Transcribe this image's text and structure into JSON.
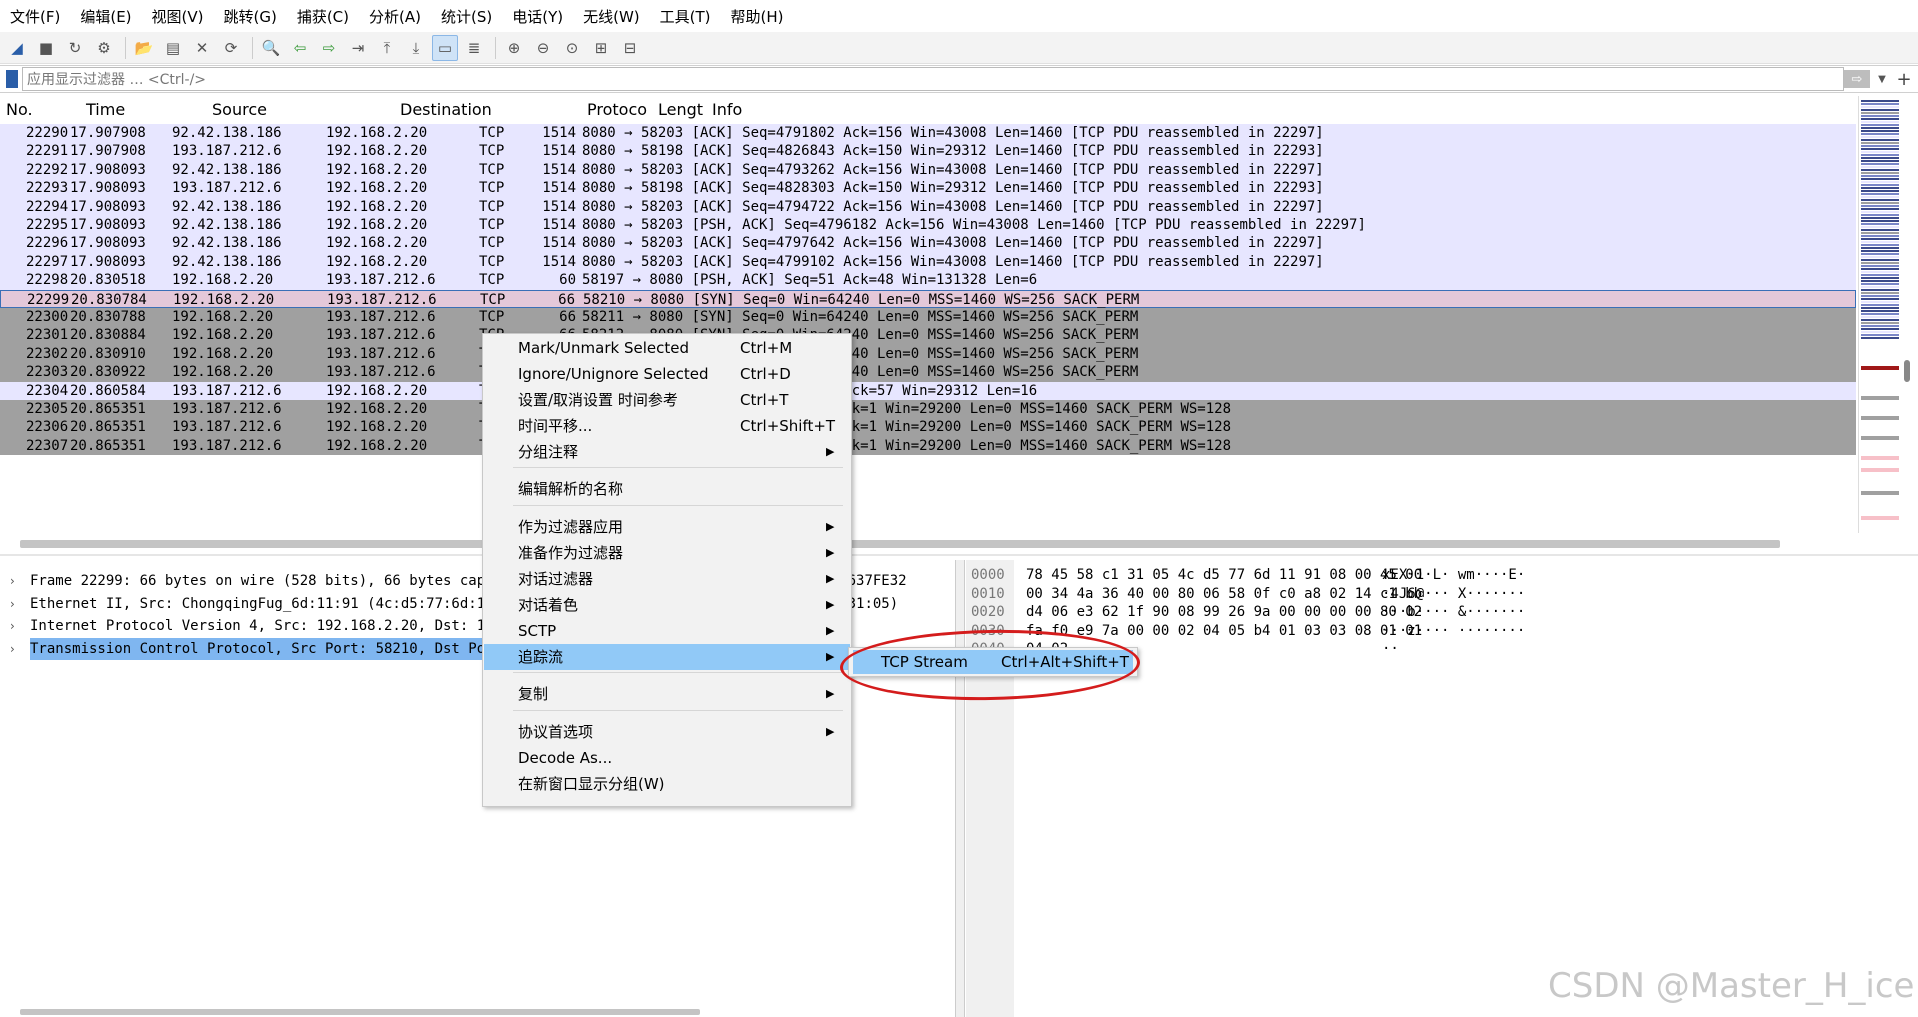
{
  "menubar": [
    "文件(F)",
    "编辑(E)",
    "视图(V)",
    "跳转(G)",
    "捕获(C)",
    "分析(A)",
    "统计(S)",
    "电话(Y)",
    "无线(W)",
    "工具(T)",
    "帮助(H)"
  ],
  "toolbar_icons": [
    "shark-fin-start-icon",
    "stop-icon",
    "restart-icon",
    "options-gear-icon",
    "open-folder-icon",
    "save-icon",
    "close-file-icon",
    "reload-icon",
    "find-icon",
    "back-arrow-icon",
    "forward-arrow-icon",
    "goto-packet-icon",
    "first-packet-icon",
    "last-packet-icon",
    "autoscroll-icon",
    "colorize-icon",
    "zoom-in-icon",
    "zoom-out-icon",
    "zoom-normal-icon",
    "resize-columns-icon",
    "layout-icon"
  ],
  "filter": {
    "placeholder": "应用显示过滤器 … <Ctrl-/>",
    "apply_glyph": "⇨",
    "add_glyph": "+"
  },
  "columns": {
    "no": "No.",
    "time": "Time",
    "source": "Source",
    "destination": "Destination",
    "protocol": "Protoco",
    "length": "Lengt",
    "info": "Info"
  },
  "packets": [
    {
      "no": "22290",
      "time": "17.907908",
      "src": "92.42.138.186",
      "dst": "192.168.2.20",
      "proto": "TCP",
      "len": "1514",
      "info": "8080 → 58203 [ACK] Seq=4791802 Ack=156 Win=43008 Len=1460 [TCP PDU reassembled in 22297]",
      "style": "tcp"
    },
    {
      "no": "22291",
      "time": "17.907908",
      "src": "193.187.212.6",
      "dst": "192.168.2.20",
      "proto": "TCP",
      "len": "1514",
      "info": "8080 → 58198 [ACK] Seq=4826843 Ack=150 Win=29312 Len=1460 [TCP PDU reassembled in 22293]",
      "style": "tcp"
    },
    {
      "no": "22292",
      "time": "17.908093",
      "src": "92.42.138.186",
      "dst": "192.168.2.20",
      "proto": "TCP",
      "len": "1514",
      "info": "8080 → 58203 [ACK] Seq=4793262 Ack=156 Win=43008 Len=1460 [TCP PDU reassembled in 22297]",
      "style": "tcp"
    },
    {
      "no": "22293",
      "time": "17.908093",
      "src": "193.187.212.6",
      "dst": "192.168.2.20",
      "proto": "TCP",
      "len": "1514",
      "info": "8080 → 58198 [ACK] Seq=4828303 Ack=150 Win=29312 Len=1460 [TCP PDU reassembled in 22293]",
      "style": "tcp"
    },
    {
      "no": "22294",
      "time": "17.908093",
      "src": "92.42.138.186",
      "dst": "192.168.2.20",
      "proto": "TCP",
      "len": "1514",
      "info": "8080 → 58203 [ACK] Seq=4794722 Ack=156 Win=43008 Len=1460 [TCP PDU reassembled in 22297]",
      "style": "tcp"
    },
    {
      "no": "22295",
      "time": "17.908093",
      "src": "92.42.138.186",
      "dst": "192.168.2.20",
      "proto": "TCP",
      "len": "1514",
      "info": "8080 → 58203 [PSH, ACK] Seq=4796182 Ack=156 Win=43008 Len=1460 [TCP PDU reassembled in 22297]",
      "style": "tcp"
    },
    {
      "no": "22296",
      "time": "17.908093",
      "src": "92.42.138.186",
      "dst": "192.168.2.20",
      "proto": "TCP",
      "len": "1514",
      "info": "8080 → 58203 [ACK] Seq=4797642 Ack=156 Win=43008 Len=1460 [TCP PDU reassembled in 22297]",
      "style": "tcp"
    },
    {
      "no": "22297",
      "time": "17.908093",
      "src": "92.42.138.186",
      "dst": "192.168.2.20",
      "proto": "TCP",
      "len": "1514",
      "info": "8080 → 58203 [ACK] Seq=4799102 Ack=156 Win=43008 Len=1460 [TCP PDU reassembled in 22297]",
      "style": "tcp"
    },
    {
      "no": "22298",
      "time": "20.830518",
      "src": "192.168.2.20",
      "dst": "193.187.212.6",
      "proto": "TCP",
      "len": "60",
      "info": "58197 → 8080 [PSH, ACK] Seq=51 Ack=48 Win=131328 Len=6",
      "style": "tcp"
    },
    {
      "no": "22299",
      "time": "20.830784",
      "src": "192.168.2.20",
      "dst": "193.187.212.6",
      "proto": "TCP",
      "len": "66",
      "info": "58210 → 8080 [SYN] Seq=0 Win=64240 Len=0 MSS=1460 WS=256 SACK_PERM",
      "style": "sel"
    },
    {
      "no": "22300",
      "time": "20.830788",
      "src": "192.168.2.20",
      "dst": "193.187.212.6",
      "proto": "TCP",
      "len": "66",
      "info": "58211 → 8080 [SYN] Seq=0 Win=64240 Len=0 MSS=1460 WS=256 SACK_PERM",
      "style": "gray"
    },
    {
      "no": "22301",
      "time": "20.830884",
      "src": "192.168.2.20",
      "dst": "193.187.212.6",
      "proto": "TCP",
      "len": "66",
      "info": "58212 → 8080 [SYN] Seq=0 Win=64240 Len=0 MSS=1460 WS=256 SACK_PERM",
      "style": "gray"
    },
    {
      "no": "22302",
      "time": "20.830910",
      "src": "192.168.2.20",
      "dst": "193.187.212.6",
      "proto": "TCP",
      "len": "66",
      "info": "58213 → 8080 [SYN] Seq=0 Win=64240 Len=0 MSS=1460 WS=256 SACK_PERM",
      "style": "gray"
    },
    {
      "no": "22303",
      "time": "20.830922",
      "src": "192.168.2.20",
      "dst": "193.187.212.6",
      "proto": "TCP",
      "len": "66",
      "info": "58214 → 8080 [SYN] Seq=0 Win=64240 Len=0 MSS=1460 WS=256 SACK_PERM",
      "style": "gray"
    },
    {
      "no": "22304",
      "time": "20.860584",
      "src": "193.187.212.6",
      "dst": "192.168.2.20",
      "proto": "TCP",
      "len": "54",
      "info": "8080 → 58197 [PSH, ACK] Seq=48 Ack=57 Win=29312 Len=16",
      "style": "tcp"
    },
    {
      "no": "22305",
      "time": "20.865351",
      "src": "193.187.212.6",
      "dst": "192.168.2.20",
      "proto": "TCP",
      "len": "66",
      "info": "8080 → 58210 [SYN, ACK] Seq=0 Ack=1 Win=29200 Len=0 MSS=1460 SACK_PERM WS=128",
      "style": "gray"
    },
    {
      "no": "22306",
      "time": "20.865351",
      "src": "193.187.212.6",
      "dst": "192.168.2.20",
      "proto": "TCP",
      "len": "66",
      "info": "8080 → 58211 [SYN, ACK] Seq=0 Ack=1 Win=29200 Len=0 MSS=1460 SACK_PERM WS=128",
      "style": "gray"
    },
    {
      "no": "22307",
      "time": "20.865351",
      "src": "193.187.212.6",
      "dst": "192.168.2.20",
      "proto": "TCP",
      "len": "66",
      "info": "8080 → 58212 [SYN, ACK] Seq=0 Ack=1 Win=29200 Len=0 MSS=1460 SACK_PERM WS=128",
      "style": "gray"
    }
  ],
  "details": [
    {
      "text": "Frame 22299: 66 bytes on wire (528 bits), 66 bytes captured (528 bits) on interface \\Device\\NPF_{637FE32",
      "selected": false
    },
    {
      "text": "Ethernet II, Src: ChongqingFug_6d:11:91 (4c:d5:77:6d:11:91), Dst: Tp-LinkT_c1:31:05 (78:45:58:c1:31:05)",
      "selected": false
    },
    {
      "text": "Internet Protocol Version 4, Src: 192.168.2.20, Dst: 193.187.212.6",
      "selected": false
    },
    {
      "text": "Transmission Control Protocol, Src Port: 58210, Dst Port: 8080, Seq: 0, Len: 0",
      "selected": true
    }
  ],
  "bytes": [
    {
      "offset": "0000",
      "hex": "78 45 58 c1 31 05 4c d5  77 6d 11 91 08 00 45 00",
      "ascii": "xEX·1·L· wm····E·"
    },
    {
      "offset": "0010",
      "hex": "00 34 4a 36 40 00 80 06  58 0f c0 a8 02 14 c1 bb",
      "ascii": "·4J6@··· X·······"
    },
    {
      "offset": "0020",
      "hex": "d4 06 e3 62 1f 90 08 99  26 9a 00 00 00 00 80 02",
      "ascii": "···b···· &·······"
    },
    {
      "offset": "0030",
      "hex": "fa f0 e9 7a 00 00 02 04  05 b4 01 03 03 08 01 01",
      "ascii": "···z···· ········"
    },
    {
      "offset": "0040",
      "hex": "04 02",
      "ascii": "··"
    }
  ],
  "context_menu": {
    "items": [
      {
        "label": "Mark/Unmark Selected",
        "shortcut": "Ctrl+M",
        "submenu": false
      },
      {
        "label": "Ignore/Unignore Selected",
        "shortcut": "Ctrl+D",
        "submenu": false
      },
      {
        "label": "设置/取消设置 时间参考",
        "shortcut": "Ctrl+T",
        "submenu": false
      },
      {
        "label": "时间平移...",
        "shortcut": "Ctrl+Shift+T",
        "submenu": false
      },
      {
        "label": "分组注释",
        "shortcut": "",
        "submenu": true
      },
      {
        "label": "编辑解析的名称",
        "shortcut": "",
        "submenu": false
      },
      {
        "label": "作为过滤器应用",
        "shortcut": "",
        "submenu": true
      },
      {
        "label": "准备作为过滤器",
        "shortcut": "",
        "submenu": true
      },
      {
        "label": "对话过滤器",
        "shortcut": "",
        "submenu": true
      },
      {
        "label": "对话着色",
        "shortcut": "",
        "submenu": true
      },
      {
        "label": "SCTP",
        "shortcut": "",
        "submenu": true
      },
      {
        "label": "追踪流",
        "shortcut": "",
        "submenu": true
      },
      {
        "label": "复制",
        "shortcut": "",
        "submenu": true
      },
      {
        "label": "协议首选项",
        "shortcut": "",
        "submenu": true
      },
      {
        "label": "Decode As...",
        "shortcut": "",
        "submenu": false
      },
      {
        "label": "在新窗口显示分组(W)",
        "shortcut": "",
        "submenu": false
      }
    ],
    "submenu_glyph": "▶"
  },
  "follow_submenu": {
    "label": "TCP Stream",
    "shortcut": "Ctrl+Alt+Shift+T"
  },
  "watermark": "CSDN @Master_H_ice",
  "colors": {
    "tcp_row": "#e7e6ff",
    "gray_row": "#a0a0a0",
    "selected_row": "#e4c8d9",
    "menu_highlight": "#91c9f7",
    "annotation_red": "#d41c1c"
  }
}
